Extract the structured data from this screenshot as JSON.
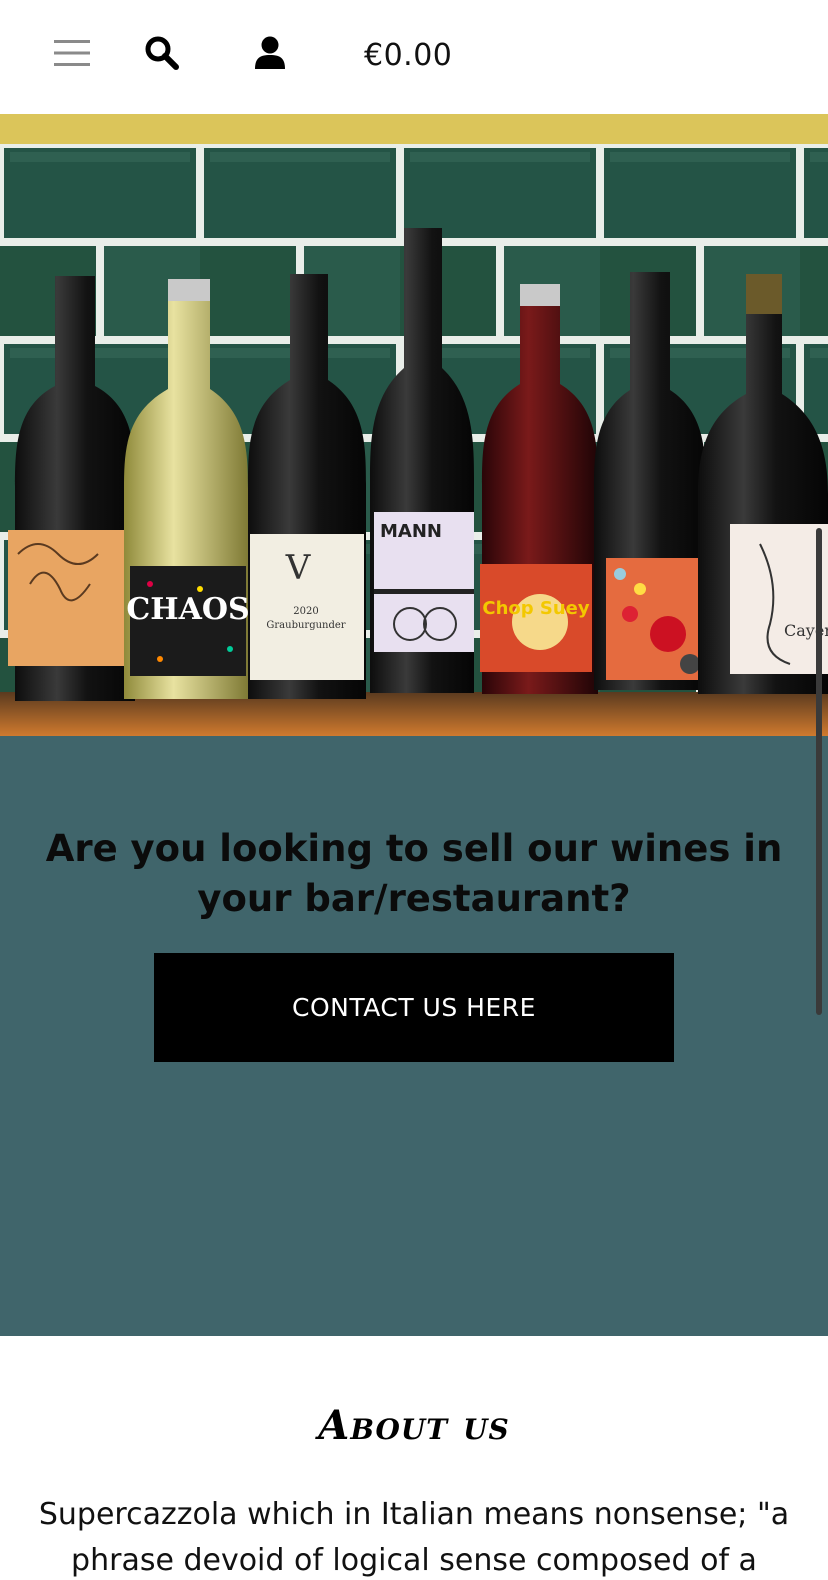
{
  "header": {
    "menu_icon": "hamburger-menu-icon",
    "search_icon": "search-icon",
    "account_icon": "user-icon",
    "cart_total": "€0.00"
  },
  "colors": {
    "accent_bar": "#dbc55a",
    "teal_section": "#40656b",
    "button_bg": "#000000"
  },
  "hero": {
    "labels": {
      "bottle2": "CHAOS",
      "bottle3_year": "2020",
      "bottle3_name": "Grauburgunder",
      "bottle4": "MANN",
      "bottle5": "Chop Suey",
      "bottle8": "Cayenne"
    }
  },
  "wholesale": {
    "heading": "Are you looking to sell our wines in your bar/restaurant?",
    "button_label": "CONTACT US HERE"
  },
  "about": {
    "title": "About us",
    "text": "Supercazzola which in Italian means nonsense; \"a phrase devoid of logical sense composed of a random"
  }
}
